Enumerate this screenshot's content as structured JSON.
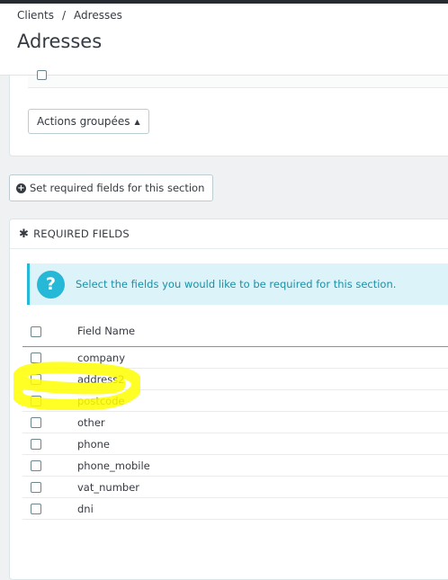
{
  "breadcrumb": {
    "parent": "Clients",
    "separator": "/",
    "current": "Adresses"
  },
  "page_title": "Adresses",
  "bulk_actions": {
    "label": "Actions groupées",
    "caret": "▲"
  },
  "required_button": {
    "icon": "plus-circle-icon",
    "label": "Set required fields for this section"
  },
  "required_panel": {
    "heading": "REQUIRED FIELDS",
    "heading_icon": "asterisk-icon",
    "info": "Select the fields you would like to be required for this section.",
    "info_icon": "question-icon",
    "column_header": "Field Name",
    "fields": [
      {
        "name": "company",
        "checked": false
      },
      {
        "name": "address2",
        "checked": false
      },
      {
        "name": "postcode",
        "checked": false
      },
      {
        "name": "other",
        "checked": false
      },
      {
        "name": "phone",
        "checked": false
      },
      {
        "name": "phone_mobile",
        "checked": false
      },
      {
        "name": "vat_number",
        "checked": false
      },
      {
        "name": "dni",
        "checked": false
      }
    ]
  },
  "colors": {
    "accent": "#25b9d7",
    "info_bg": "#dcf4f9",
    "highlight": "#ffff00",
    "text": "#363a41"
  }
}
